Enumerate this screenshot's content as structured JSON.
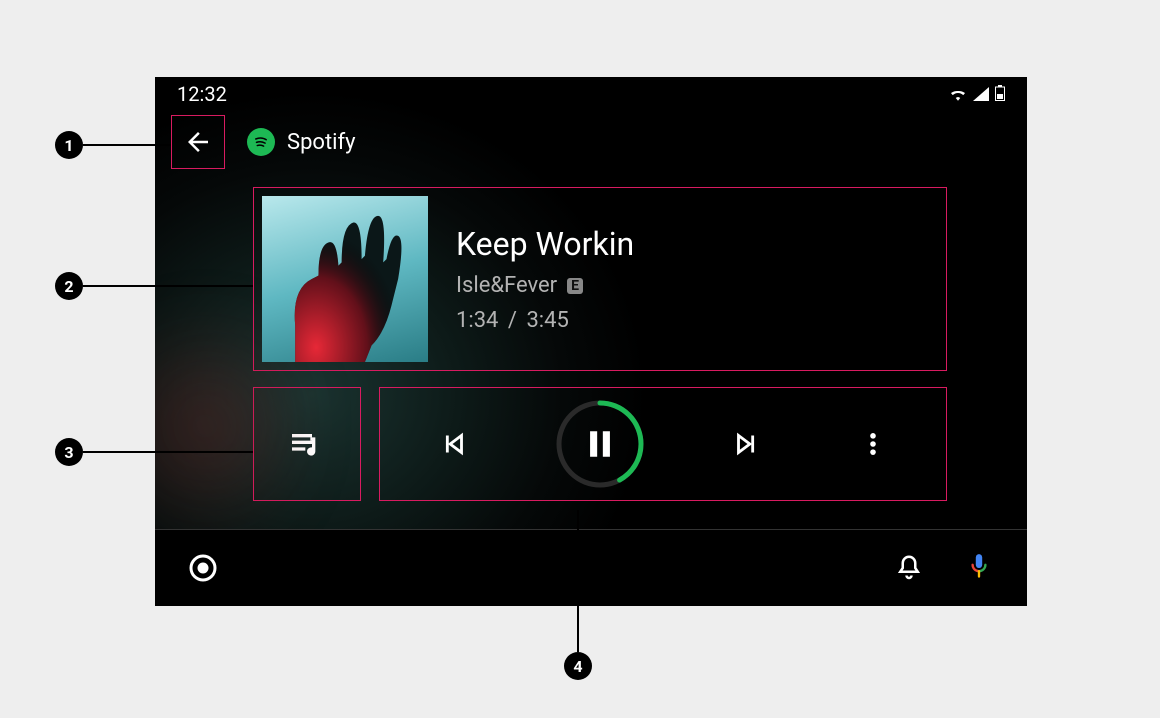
{
  "status": {
    "time": "12:32"
  },
  "header": {
    "app_name": "Spotify"
  },
  "track": {
    "title": "Keep Workin",
    "artist": "Isle&Fever",
    "explicit_label": "E",
    "elapsed": "1:34",
    "separator": "/",
    "duration": "3:45"
  },
  "annotations": {
    "a1": "1",
    "a2": "2",
    "a3": "3",
    "a4": "4"
  }
}
